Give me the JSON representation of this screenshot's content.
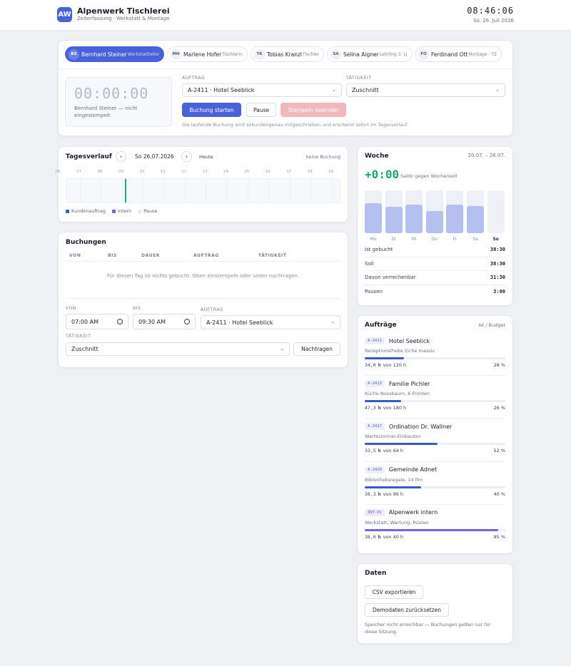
{
  "header": {
    "logo": "AW",
    "title": "Alpenwerk Tischlerei",
    "subtitle": "Zeiterfassung · Werkstatt & Montage",
    "clock": "08:46:06",
    "date": "So, 26. Juli 2026"
  },
  "workers": [
    {
      "initials": "BS",
      "name": "Bernhard Steiner",
      "role": "Werkstattleiter",
      "active": true
    },
    {
      "initials": "MH",
      "name": "Marlene Hofer",
      "role": "Tischlerin",
      "active": false
    },
    {
      "initials": "TK",
      "name": "Tobias Kranzl",
      "role": "Tischler",
      "active": false
    },
    {
      "initials": "SA",
      "name": "Selina Aigner",
      "role": "Lehrling 3. LJ",
      "active": false
    },
    {
      "initials": "FO",
      "name": "Ferdinand Ott",
      "role": "Montage · TZ",
      "active": false
    }
  ],
  "stamp": {
    "timer": "00:00:00",
    "status": "Bernhard Steiner — nicht eingestempelt",
    "auftrag_label": "AUFTRAG",
    "auftrag_value": "A-2411 · Hotel Seeblick",
    "taetigkeit_label": "TÄTIGKEIT",
    "taetigkeit_value": "Zuschnitt",
    "start_label": "Buchung starten",
    "pause_label": "Pause",
    "end_label": "Stempeln beenden",
    "hint": "Die laufende Buchung wird sekundengenau mitgeschrieben und erscheint sofort im Tagesverlauf."
  },
  "timeline": {
    "title": "Tagesverlauf",
    "prev": "‹",
    "next": "›",
    "date": "So 26.07.2026",
    "today": "Heute",
    "status": "keine Buchung",
    "hours": [
      "06",
      "07",
      "08",
      "09",
      "10",
      "11",
      "12",
      "13",
      "14",
      "15",
      "16",
      "17",
      "18",
      "19"
    ],
    "now_hour": 8.77,
    "legend": [
      {
        "label": "Kundenauftrag",
        "color": "#3f56c8"
      },
      {
        "label": "Intern",
        "color": "#7b5fe0"
      },
      {
        "label": "Pause",
        "color": "#e9ebf0"
      }
    ]
  },
  "bookings": {
    "title": "Buchungen",
    "columns": [
      "VON",
      "BIS",
      "DAUER",
      "AUFTRAG",
      "TÄTIGKEIT"
    ],
    "empty": "Für diesen Tag ist nichts gebucht. Oben einstempeln oder unten nachtragen.",
    "von_label": "VON",
    "von_value": "07:00 AM",
    "bis_label": "BIS",
    "bis_value": "09:30 AM",
    "auftrag_label": "AUFTRAG",
    "auftrag_value": "A-2411 · Hotel Seeblick",
    "taetigkeit_label": "TÄTIGKEIT",
    "taetigkeit_value": "Zuschnitt",
    "submit_label": "Nachtragen"
  },
  "week": {
    "title": "Woche",
    "range": "20.07. – 26.07.",
    "saldo": "+0:00",
    "saldo_label": "Saldo gegen Wochensoll",
    "days": [
      {
        "label": "Mo",
        "fill": 0.7,
        "bold": false
      },
      {
        "label": "Di",
        "fill": 0.62,
        "bold": false
      },
      {
        "label": "Mi",
        "fill": 0.66,
        "bold": false
      },
      {
        "label": "Do",
        "fill": 0.52,
        "bold": false
      },
      {
        "label": "Fr",
        "fill": 0.66,
        "bold": false
      },
      {
        "label": "Sa",
        "fill": 0.64,
        "bold": false
      },
      {
        "label": "So",
        "fill": 0.0,
        "bold": true
      }
    ],
    "stats": [
      {
        "label": "Ist gebucht",
        "value": "38:30"
      },
      {
        "label": "Soll",
        "value": "38:30"
      },
      {
        "label": "Davon verrechenbar",
        "value": "31:30"
      },
      {
        "label": "Pausen",
        "value": "3:00"
      }
    ]
  },
  "orders": {
    "title": "Aufträge",
    "meta": "Ist / Budget",
    "items": [
      {
        "code": "A-2411",
        "name": "Hotel Seeblick",
        "desc": "Rezeptionstheke Eiche massiv",
        "ist": "34,0",
        "unit": "h",
        "budget": "von 120 h",
        "pct": "28 %",
        "fill": 0.28,
        "internal": false
      },
      {
        "code": "A-2413",
        "name": "Familie Pichler",
        "desc": "Küche Nussbaum, 6 Fronten",
        "ist": "47,3",
        "unit": "h",
        "budget": "von 180 h",
        "pct": "26 %",
        "fill": 0.26,
        "internal": false
      },
      {
        "code": "A-2417",
        "name": "Ordination Dr. Wallner",
        "desc": "Wartezimmer-Einbauten",
        "ist": "33,5",
        "unit": "h",
        "budget": "von 64 h",
        "pct": "52 %",
        "fill": 0.52,
        "internal": false
      },
      {
        "code": "A-2420",
        "name": "Gemeinde Adnet",
        "desc": "Bibliotheksregale, 14 lfm",
        "ist": "38,3",
        "unit": "h",
        "budget": "von 96 h",
        "pct": "40 %",
        "fill": 0.4,
        "internal": false
      },
      {
        "code": "INT-01",
        "name": "Alpenwerk intern",
        "desc": "Werkstatt, Wartung, Rüsten",
        "ist": "38,0",
        "unit": "h",
        "budget": "von 40 h",
        "pct": "95 %",
        "fill": 0.95,
        "internal": true
      }
    ]
  },
  "daten": {
    "title": "Daten",
    "export_label": "CSV exportieren",
    "reset_label": "Demodaten zurücksetzen",
    "note": "Speicher nicht erreichbar — Buchungen gelten nur für diese Sitzung."
  },
  "colors": {
    "accent": "#4a62d8",
    "client": "#3f56c8",
    "internal": "#7b5fe0",
    "saldo": "#1fa57a",
    "now_line": "#1fa57a"
  }
}
